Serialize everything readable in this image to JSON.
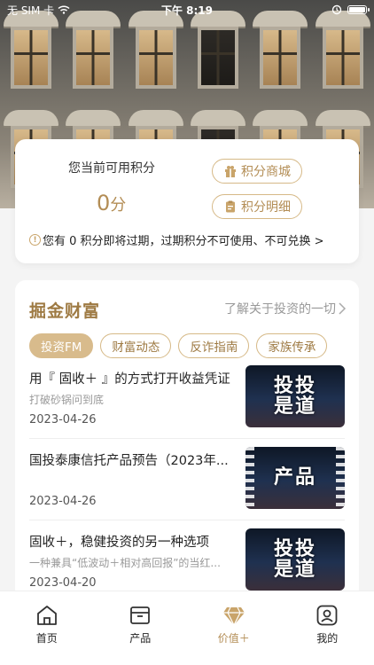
{
  "status_bar": {
    "carrier": "无 SIM 卡",
    "time": "下午 8:19"
  },
  "points": {
    "label": "您当前可用积分",
    "value": "0",
    "unit": "分",
    "shop_button": "积分商城",
    "detail_button": "积分明细",
    "notice": "您有 0 积分即将过期，过期积分不可使用、不可兑换 >"
  },
  "wealth": {
    "title": "掘金财富",
    "link": "了解关于投资的一切",
    "tabs": [
      {
        "label": "投资FM",
        "active": true
      },
      {
        "label": "财富动态",
        "active": false
      },
      {
        "label": "反诈指南",
        "active": false
      },
      {
        "label": "家族传承",
        "active": false
      }
    ],
    "articles": [
      {
        "title": "用『 固收＋ 』的方式打开收益凭证",
        "subtitle": "打破砂锅问到底",
        "date": "2023-04-26",
        "thumb_text": "投投\n是道"
      },
      {
        "title": "国投泰康信托产品预告（2023年...",
        "subtitle": "",
        "date": "2023-04-26",
        "thumb_text": "产品"
      },
      {
        "title": "固收＋，稳健投资的另一种选项",
        "subtitle": "一种兼具“低波动＋相对高回报”的当红...",
        "date": "2023-04-20",
        "thumb_text": "投投\n是道"
      }
    ]
  },
  "nav": [
    {
      "label": "首页",
      "icon": "home-icon",
      "active": false
    },
    {
      "label": "产品",
      "icon": "box-icon",
      "active": false
    },
    {
      "label": "价值＋",
      "icon": "diamond-icon",
      "active": true
    },
    {
      "label": "我的",
      "icon": "profile-icon",
      "active": false
    }
  ],
  "colors": {
    "accent": "#b38d55",
    "tab_active_bg": "#d8bb8c",
    "title_gold": "#9e7a43"
  }
}
